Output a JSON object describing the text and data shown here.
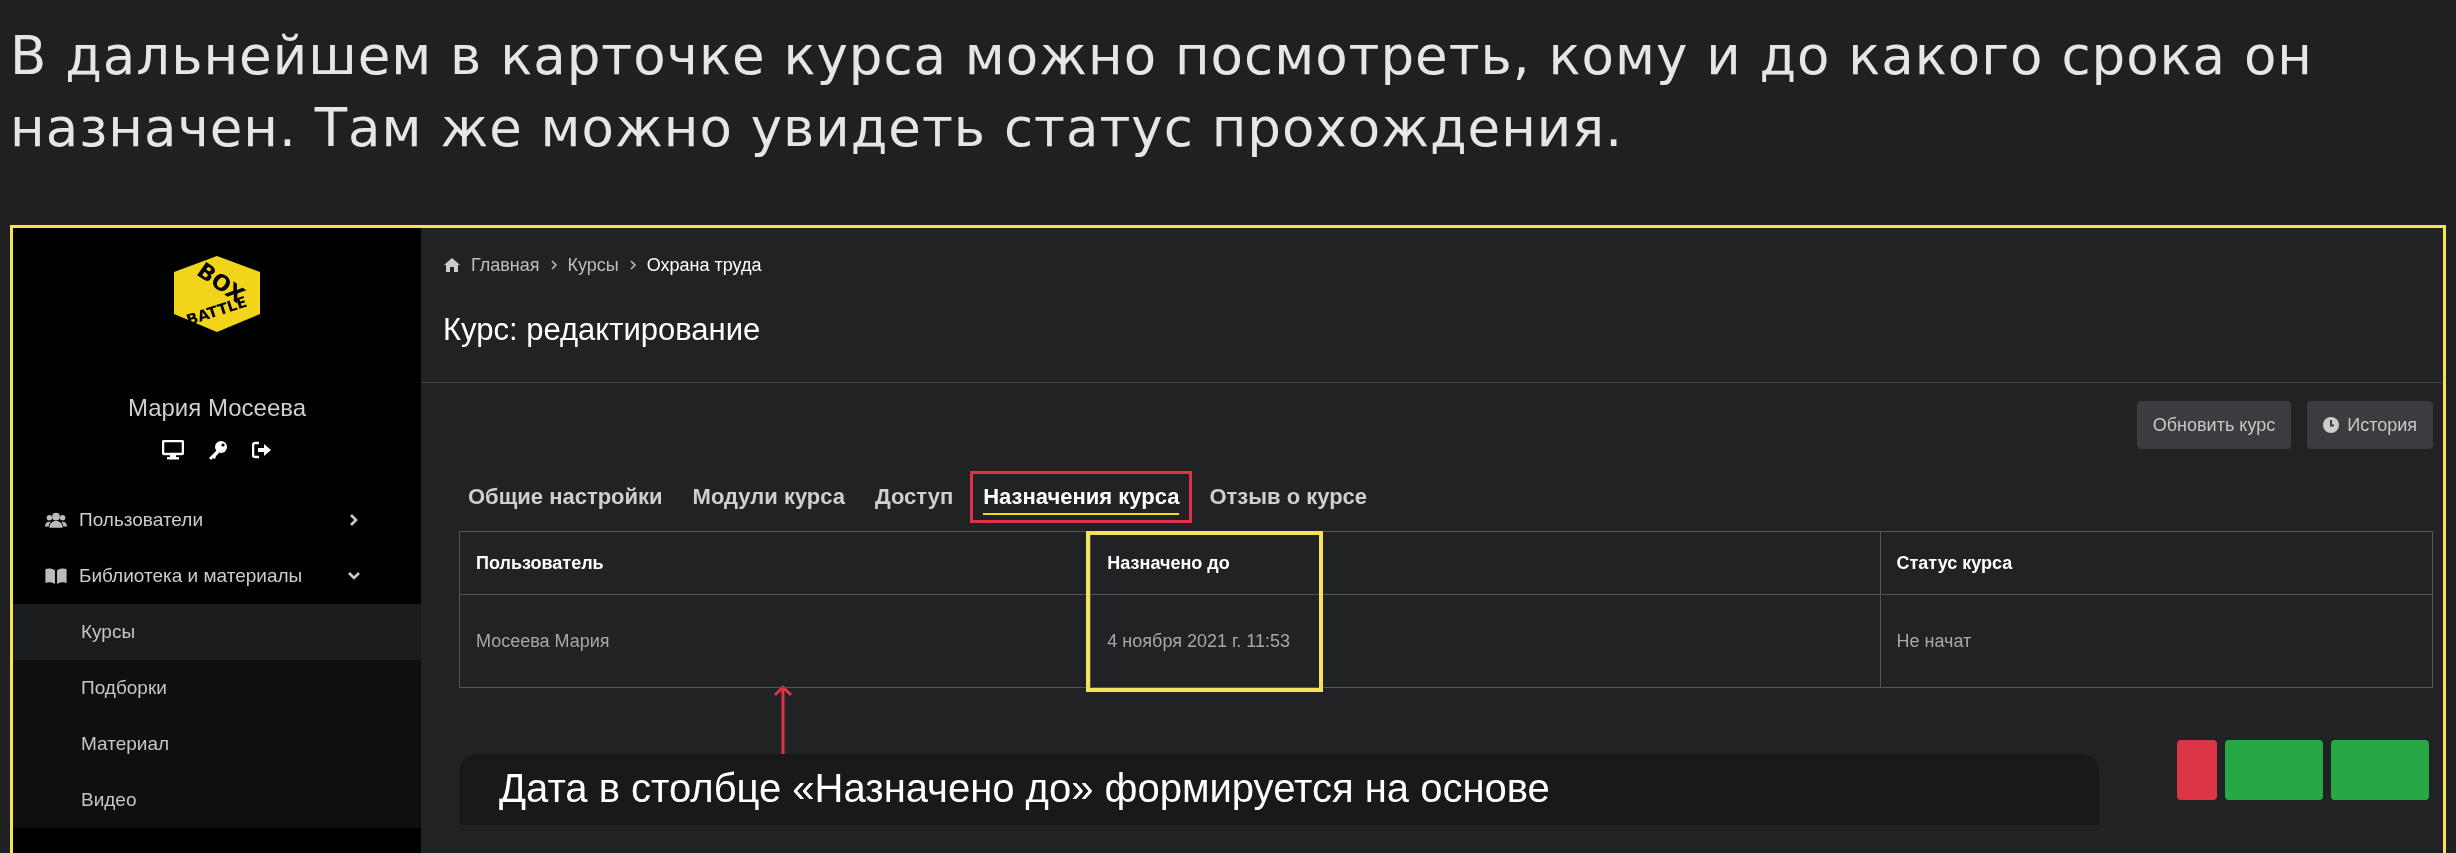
{
  "heading": "В дальнейшем в карточке курса можно посмотреть, кому и до какого срока он назначен. Там же можно увидеть статус прохождения.",
  "sidebar": {
    "logo": {
      "lines": [
        "BOX",
        "BATTLE"
      ]
    },
    "user_name": "Мария Мосеева",
    "items": [
      {
        "label": "Пользователи",
        "expanded": false
      },
      {
        "label": "Библиотека и материалы",
        "expanded": true,
        "children": [
          {
            "label": "Курсы",
            "selected": true
          },
          {
            "label": "Подборки",
            "selected": false
          },
          {
            "label": "Материал",
            "selected": false
          },
          {
            "label": "Видео",
            "selected": false
          }
        ]
      }
    ]
  },
  "breadcrumb": [
    {
      "label": "Главная",
      "current": false
    },
    {
      "label": "Курсы",
      "current": false
    },
    {
      "label": "Охрана  труда",
      "current": true
    }
  ],
  "page_title": "Курс: редактирование",
  "toolbar": [
    {
      "label": "Обновить курс"
    },
    {
      "label": "История"
    }
  ],
  "tabs": [
    {
      "label": "Общие настройки",
      "selected": false,
      "highlighted": false
    },
    {
      "label": "Модули курса",
      "selected": false,
      "highlighted": false
    },
    {
      "label": "Доступ",
      "selected": false,
      "highlighted": false
    },
    {
      "label": "Назначения курса",
      "selected": true,
      "highlighted": true
    },
    {
      "label": "Отзыв о курсе",
      "selected": false,
      "highlighted": false
    }
  ],
  "table": {
    "columns": [
      {
        "label": "Пользователь",
        "highlighted": false
      },
      {
        "label": "Назначено до",
        "highlighted": true
      },
      {
        "label": "Статус курса",
        "highlighted": false
      }
    ],
    "rows": [
      [
        "Мосеева Мария",
        "4 ноября 2021 г. 11:53",
        "Не начат"
      ]
    ]
  },
  "callout": "Дата в столбце «Назначено до» формируется на основе",
  "bottom_buttons": [
    {
      "color": "#dc3545"
    },
    {
      "color": "#28a745"
    },
    {
      "color": "#28a745"
    }
  ]
}
